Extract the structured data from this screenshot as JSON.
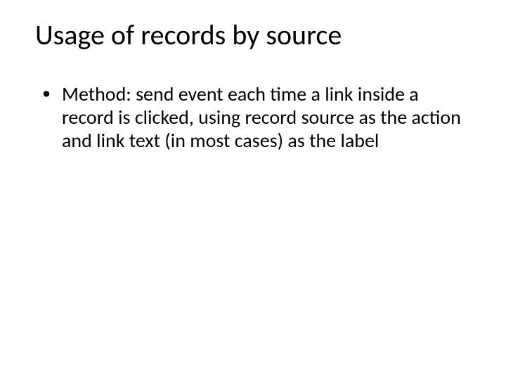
{
  "slide": {
    "title": "Usage of records by source",
    "bullets": [
      "Method: send event each time a link inside a record is clicked, using record source as the action and link text (in most cases) as the label"
    ]
  }
}
